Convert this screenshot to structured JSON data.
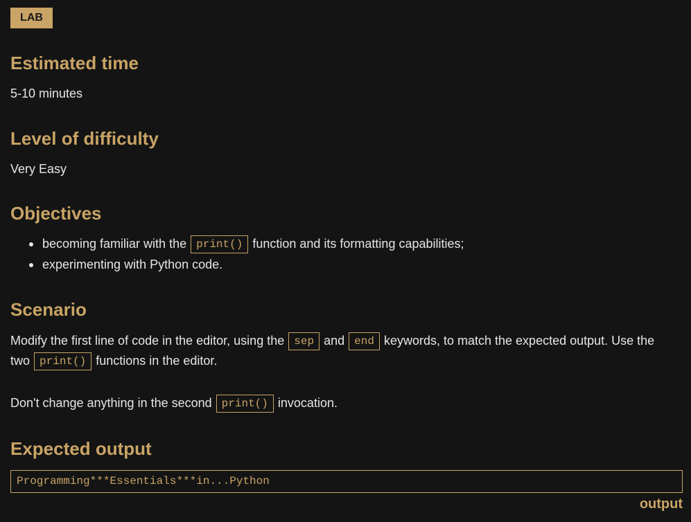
{
  "badge": "LAB",
  "estimated_time": {
    "heading": "Estimated time",
    "value": "5-10 minutes"
  },
  "difficulty": {
    "heading": "Level of difficulty",
    "value": "Very Easy"
  },
  "objectives": {
    "heading": "Objectives",
    "items": [
      {
        "before": "becoming familiar with the",
        "code": "print()",
        "after": "function and its formatting capabilities;"
      },
      {
        "text": "experimenting with Python code."
      }
    ]
  },
  "scenario": {
    "heading": "Scenario",
    "line1_a": "Modify the first line of code in the editor, using the",
    "code_sep": "sep",
    "line1_b": "and",
    "code_end": "end",
    "line1_c": "keywords, to match the expected output. Use the",
    "line2_a": "two",
    "code_print": "print()",
    "line2_b": "functions in the editor.",
    "line3_a": "Don't change anything in the second",
    "code_print2": "print()",
    "line3_b": "invocation."
  },
  "expected_output": {
    "heading": "Expected output",
    "text": "Programming***Essentials***in...Python",
    "label": "output"
  },
  "colors": {
    "background": "#141414",
    "accent": "#c9a466",
    "text": "#e6e6e6"
  }
}
